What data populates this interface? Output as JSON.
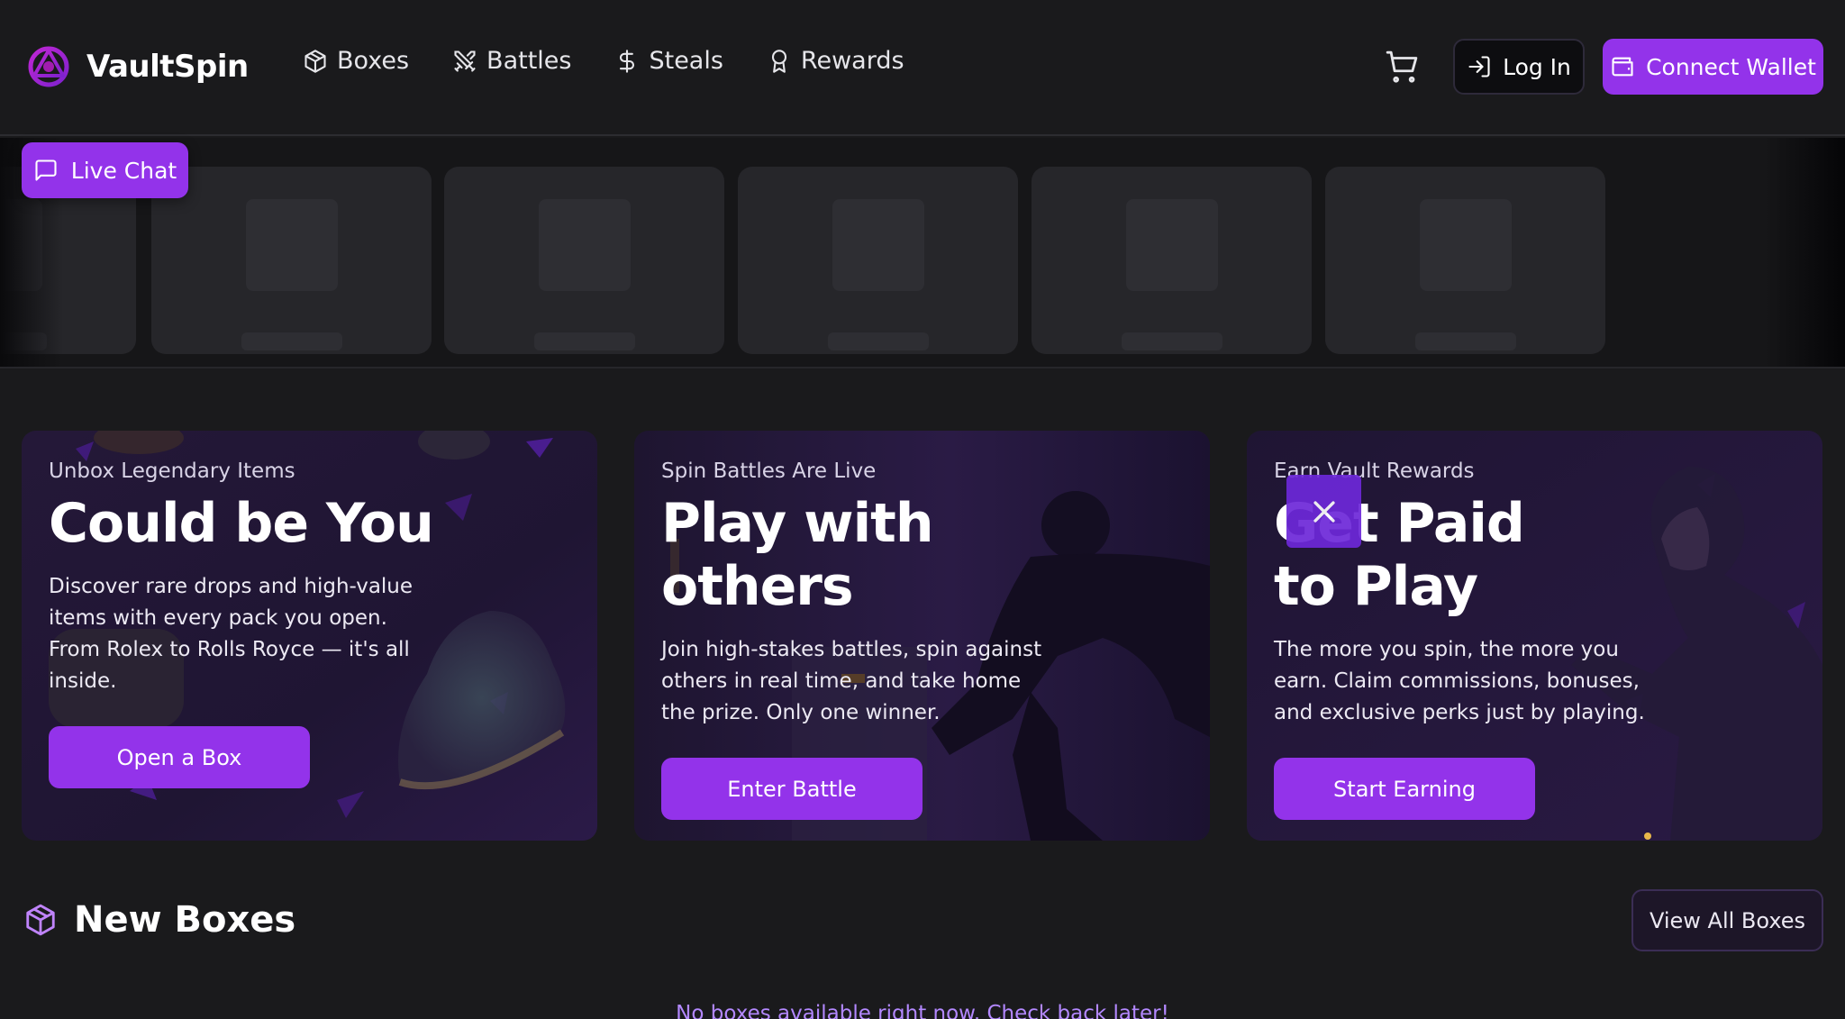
{
  "brand": {
    "name": "VaultSpin",
    "accent": "#9333ea",
    "logo_icon": "vaultspin-logo-icon"
  },
  "nav": {
    "links": [
      {
        "label": "Boxes",
        "icon": "box-icon"
      },
      {
        "label": "Battles",
        "icon": "crossed-swords-icon"
      },
      {
        "label": "Steals",
        "icon": "dollar-icon"
      },
      {
        "label": "Rewards",
        "icon": "award-ribbon-icon"
      }
    ],
    "cart_icon": "cart-icon",
    "login_label": "Log In",
    "login_icon": "log-in-icon",
    "wallet_label": "Connect Wallet",
    "wallet_icon": "wallet-icon"
  },
  "live_chat": {
    "label": "Live Chat",
    "icon": "message-square-icon"
  },
  "promos": [
    {
      "eyebrow": "Unbox Legendary Items",
      "title": "Could be You",
      "description": "Discover rare drops and high-value items with every pack you open. From Rolex to Rolls Royce — it's all inside.",
      "button": "Open a Box"
    },
    {
      "eyebrow": "Spin Battles Are Live",
      "title": "Play with others",
      "description": "Join high-stakes battles, spin against others in real time, and take home the prize. Only one winner.",
      "button": "Enter Battle"
    },
    {
      "eyebrow": "Earn Vault Rewards",
      "title": "Get Paid to Play",
      "description": "The more you spin, the more you earn. Claim commissions, bonuses, and exclusive perks just by playing.",
      "button": "Start Earning"
    }
  ],
  "overlay": {
    "close_icon": "close-icon"
  },
  "new_boxes": {
    "title": "New Boxes",
    "icon": "box-icon",
    "view_all": "View All Boxes",
    "empty_message": "No boxes available right now. Check back later!"
  }
}
